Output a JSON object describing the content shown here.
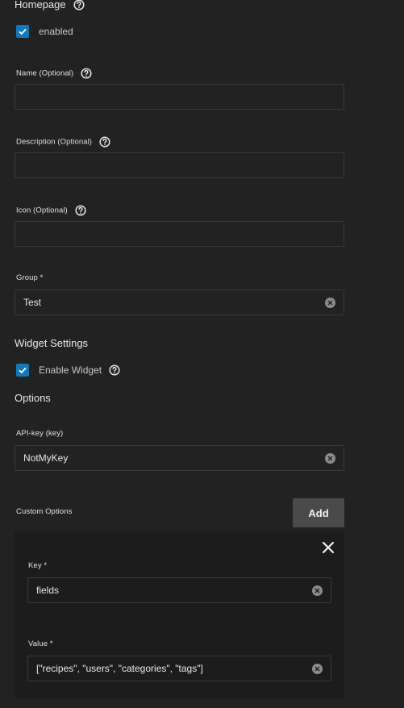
{
  "homepage": {
    "title": "Homepage",
    "enabled_label": "enabled",
    "enabled_checked": true
  },
  "fields": {
    "name": {
      "label": "Name (Optional)",
      "value": ""
    },
    "description": {
      "label": "Description (Optional)",
      "value": ""
    },
    "icon": {
      "label": "Icon (Optional)",
      "value": ""
    },
    "group": {
      "label": "Group *",
      "value": "Test"
    }
  },
  "widget": {
    "title": "Widget Settings",
    "enable_label": "Enable Widget",
    "enable_checked": true
  },
  "options": {
    "title": "Options",
    "api_key": {
      "label": "API-key (key)",
      "value": "NotMyKey"
    }
  },
  "custom_options": {
    "title": "Custom Options",
    "add_label": "Add",
    "items": [
      {
        "key_label": "Key *",
        "key_value": "fields",
        "value_label": "Value *",
        "value_value": "[\"recipes\", \"users\", \"categories\", \"tags\"]"
      }
    ]
  },
  "colors": {
    "background": "#222222",
    "checkbox": "#1478b8",
    "input_border": "#3a3a3a",
    "button": "#4a4a4a",
    "panel": "#1c1c1c"
  }
}
